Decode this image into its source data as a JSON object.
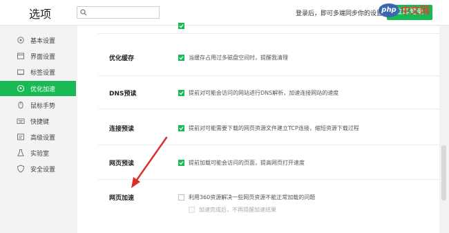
{
  "header": {
    "title": "选项",
    "search_placeholder": "",
    "login_tip": "登录后，即可多端同步你的设置",
    "login_button": "立即登录"
  },
  "watermark": {
    "logo": "php",
    "text": "中文网"
  },
  "sidebar": {
    "items": [
      {
        "label": "基本设置",
        "icon": "gear-icon"
      },
      {
        "label": "界面设置",
        "icon": "window-icon"
      },
      {
        "label": "标签设置",
        "icon": "tab-icon"
      },
      {
        "label": "优化加速",
        "icon": "rocket-icon",
        "active": true
      },
      {
        "label": "鼠标手势",
        "icon": "mouse-icon"
      },
      {
        "label": "快捷键",
        "icon": "keyboard-icon"
      },
      {
        "label": "高级设置",
        "icon": "advanced-settings-icon"
      },
      {
        "label": "实验室",
        "icon": "flask-icon"
      },
      {
        "label": "安全设置",
        "icon": "shield-icon"
      }
    ]
  },
  "sections": {
    "cache": {
      "label": "优化缓存",
      "option": "当缓存占用过多磁盘空间时，提醒我清理",
      "checked": true
    },
    "dns": {
      "label": "DNS预读",
      "option": "提前对可能会访问的网站进行DNS解析，加速连接网站的速度",
      "checked": true
    },
    "connect": {
      "label": "连接预读",
      "option": "提前对可能需要下载的网页资源文件建立TCP连接，缩短资源下载过程",
      "checked": true
    },
    "page": {
      "label": "网页预读",
      "option": "提前加载可能会访问的页面，提高网页打开速度",
      "checked": true
    },
    "accel": {
      "label": "网页加速",
      "option": "利用360资源解决一些网页资源不能正常加载的问题",
      "checked": false,
      "sub_option": "加速完成后，不再提醒加速结果",
      "sub_checked": false
    }
  },
  "colors": {
    "accent": "#19b955",
    "annotation_arrow": "#d9302b"
  }
}
